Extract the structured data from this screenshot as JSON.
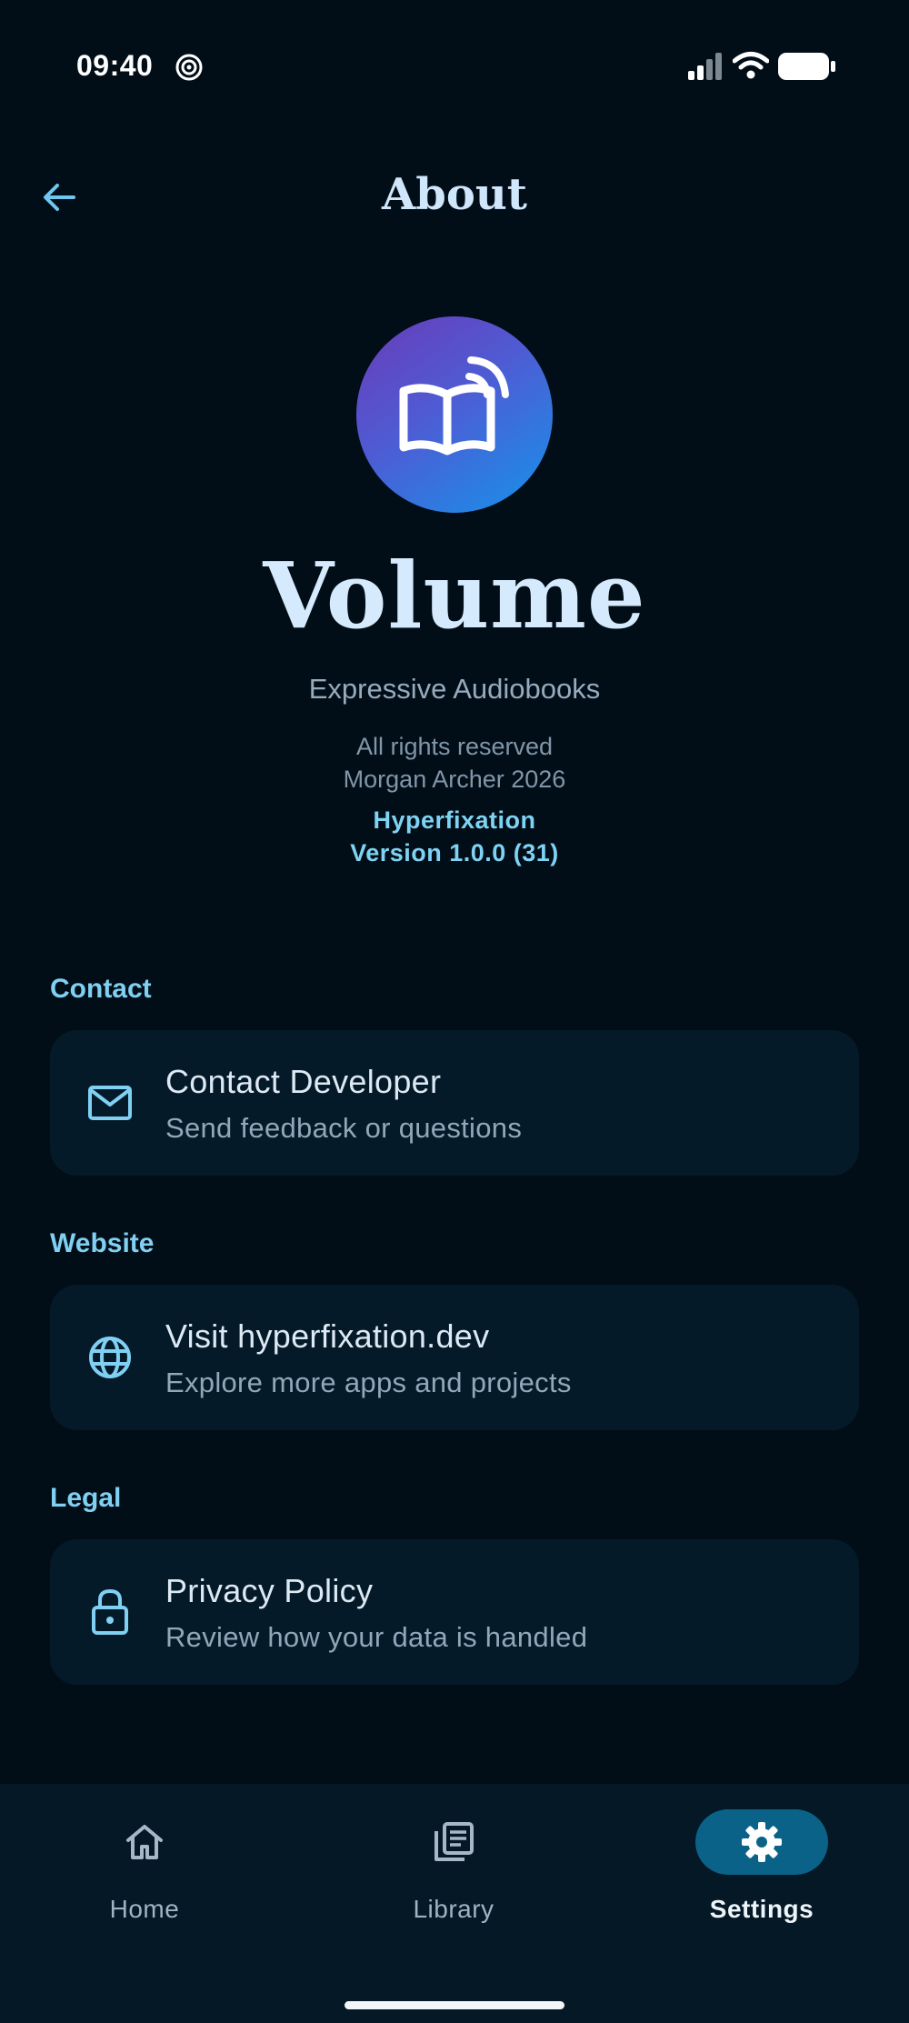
{
  "status_bar": {
    "time": "09:40",
    "icons": [
      "focus-icon",
      "signal-icon",
      "wifi-icon",
      "battery-icon"
    ]
  },
  "header": {
    "title": "About",
    "back_icon": "arrow-left-icon"
  },
  "app": {
    "name": "Volume",
    "tagline": "Expressive Audiobooks",
    "rights_line_1": "All rights reserved",
    "rights_line_2": "Morgan Archer 2026",
    "publisher": "Hyperfixation",
    "version": "Version 1.0.0 (31)",
    "icon": "book-broadcast-icon"
  },
  "sections": [
    {
      "label": "Contact",
      "item": {
        "title": "Contact Developer",
        "subtitle": "Send feedback or questions",
        "icon": "mail-icon"
      }
    },
    {
      "label": "Website",
      "item": {
        "title": "Visit hyperfixation.dev",
        "subtitle": "Explore more apps and projects",
        "icon": "globe-icon"
      }
    },
    {
      "label": "Legal",
      "item": {
        "title": "Privacy Policy",
        "subtitle": "Review how your data is handled",
        "icon": "lock-icon"
      }
    }
  ],
  "bottom_nav": {
    "items": [
      {
        "label": "Home",
        "icon": "home-icon",
        "active": false
      },
      {
        "label": "Library",
        "icon": "library-icon",
        "active": false
      },
      {
        "label": "Settings",
        "icon": "gear-icon",
        "active": true
      }
    ]
  },
  "colors": {
    "background": "#020e17",
    "card": "#051a29",
    "accent": "#7fd0f2",
    "nav_active": "#0a6289"
  }
}
